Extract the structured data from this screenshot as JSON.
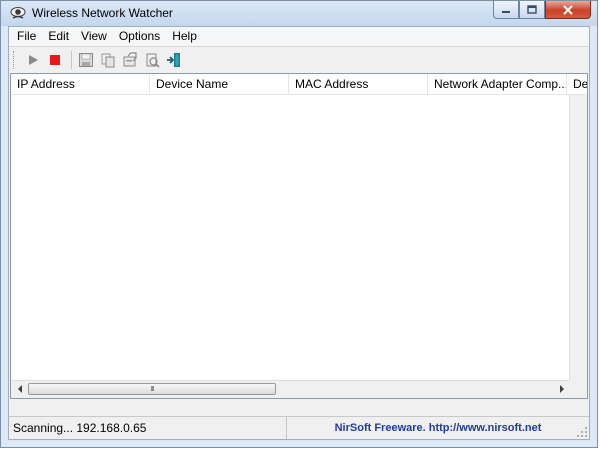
{
  "window": {
    "title": "Wireless Network Watcher"
  },
  "menu": [
    "File",
    "Edit",
    "View",
    "Options",
    "Help"
  ],
  "toolbar": {
    "icons": [
      "play-icon",
      "stop-icon",
      "save-icon",
      "copy-icon",
      "properties-icon",
      "refresh-icon",
      "exit-icon"
    ]
  },
  "table": {
    "columns": [
      "IP Address",
      "Device Name",
      "MAC Address",
      "Network Adapter Comp...",
      "De"
    ],
    "rows": []
  },
  "scrollbar": {
    "thumb_label": "III"
  },
  "status": {
    "left": "Scanning... 192.168.0.65",
    "right": "NirSoft Freeware.  http://www.nirsoft.net"
  },
  "colors": {
    "stop": "#e81818",
    "play": "#8a8a8a",
    "link": "#1f3d9c",
    "close_button": "#c7432a"
  }
}
